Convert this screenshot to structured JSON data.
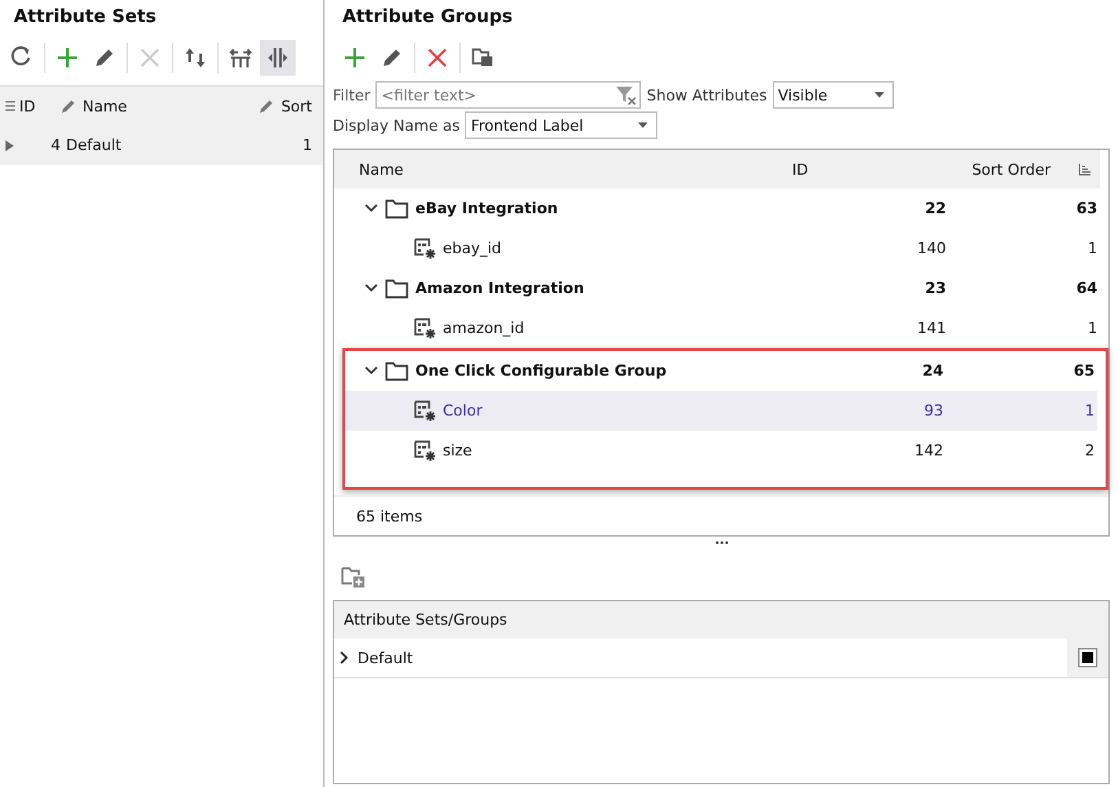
{
  "attribute_sets": {
    "title": "Attribute Sets",
    "toolbar": [
      {
        "kind": "refresh",
        "disabled": false,
        "selected": false
      },
      {
        "kind": "add",
        "disabled": false,
        "selected": false
      },
      {
        "kind": "edit",
        "disabled": false,
        "selected": false
      },
      {
        "kind": "delete",
        "disabled": true,
        "selected": false
      },
      {
        "kind": "move",
        "disabled": false,
        "selected": false
      },
      {
        "kind": "split",
        "disabled": false,
        "selected": false
      },
      {
        "kind": "columns",
        "disabled": false,
        "selected": true
      }
    ],
    "columns": [
      {
        "label": "ID",
        "kind": "plain"
      },
      {
        "label": "Name",
        "kind": "editable"
      },
      {
        "label": "Sort",
        "kind": "editable"
      }
    ],
    "rows": [
      {
        "id": "4",
        "name": "Default",
        "sort": "1",
        "selected": true
      }
    ]
  },
  "attribute_groups": {
    "title": "Attribute Groups",
    "toolbar": [
      {
        "kind": "add",
        "disabled": false
      },
      {
        "kind": "edit",
        "disabled": false
      },
      {
        "kind": "delete",
        "disabled": false
      },
      {
        "kind": "copy",
        "disabled": false
      }
    ],
    "filter": {
      "label": "Filter",
      "placeholder": "<filter text>"
    },
    "show_attributes": {
      "label": "Show Attributes",
      "value": "Visible"
    },
    "display_name": {
      "label": "Display Name as",
      "value": "Frontend Label"
    },
    "columns": [
      "Name",
      "ID",
      "Sort Order"
    ],
    "groups": [
      {
        "name": "eBay Integration",
        "id": "22",
        "sort": "63",
        "expanded": true,
        "highlighted": false,
        "children": [
          {
            "name": "ebay_id",
            "id": "140",
            "sort": "1",
            "selected": false
          }
        ]
      },
      {
        "name": "Amazon Integration",
        "id": "23",
        "sort": "64",
        "expanded": true,
        "highlighted": false,
        "children": [
          {
            "name": "amazon_id",
            "id": "141",
            "sort": "1",
            "selected": false
          }
        ]
      },
      {
        "name": "One Click Configurable Group",
        "id": "24",
        "sort": "65",
        "expanded": true,
        "highlighted": true,
        "children": [
          {
            "name": "Color",
            "id": "93",
            "sort": "1",
            "selected": true
          },
          {
            "name": "size",
            "id": "142",
            "sort": "2",
            "selected": false
          }
        ]
      }
    ],
    "footer": "65 items"
  },
  "sets_groups": {
    "header": "Attribute Sets/Groups",
    "rows": [
      {
        "name": "Default",
        "expanded": false,
        "checked": true
      }
    ]
  }
}
